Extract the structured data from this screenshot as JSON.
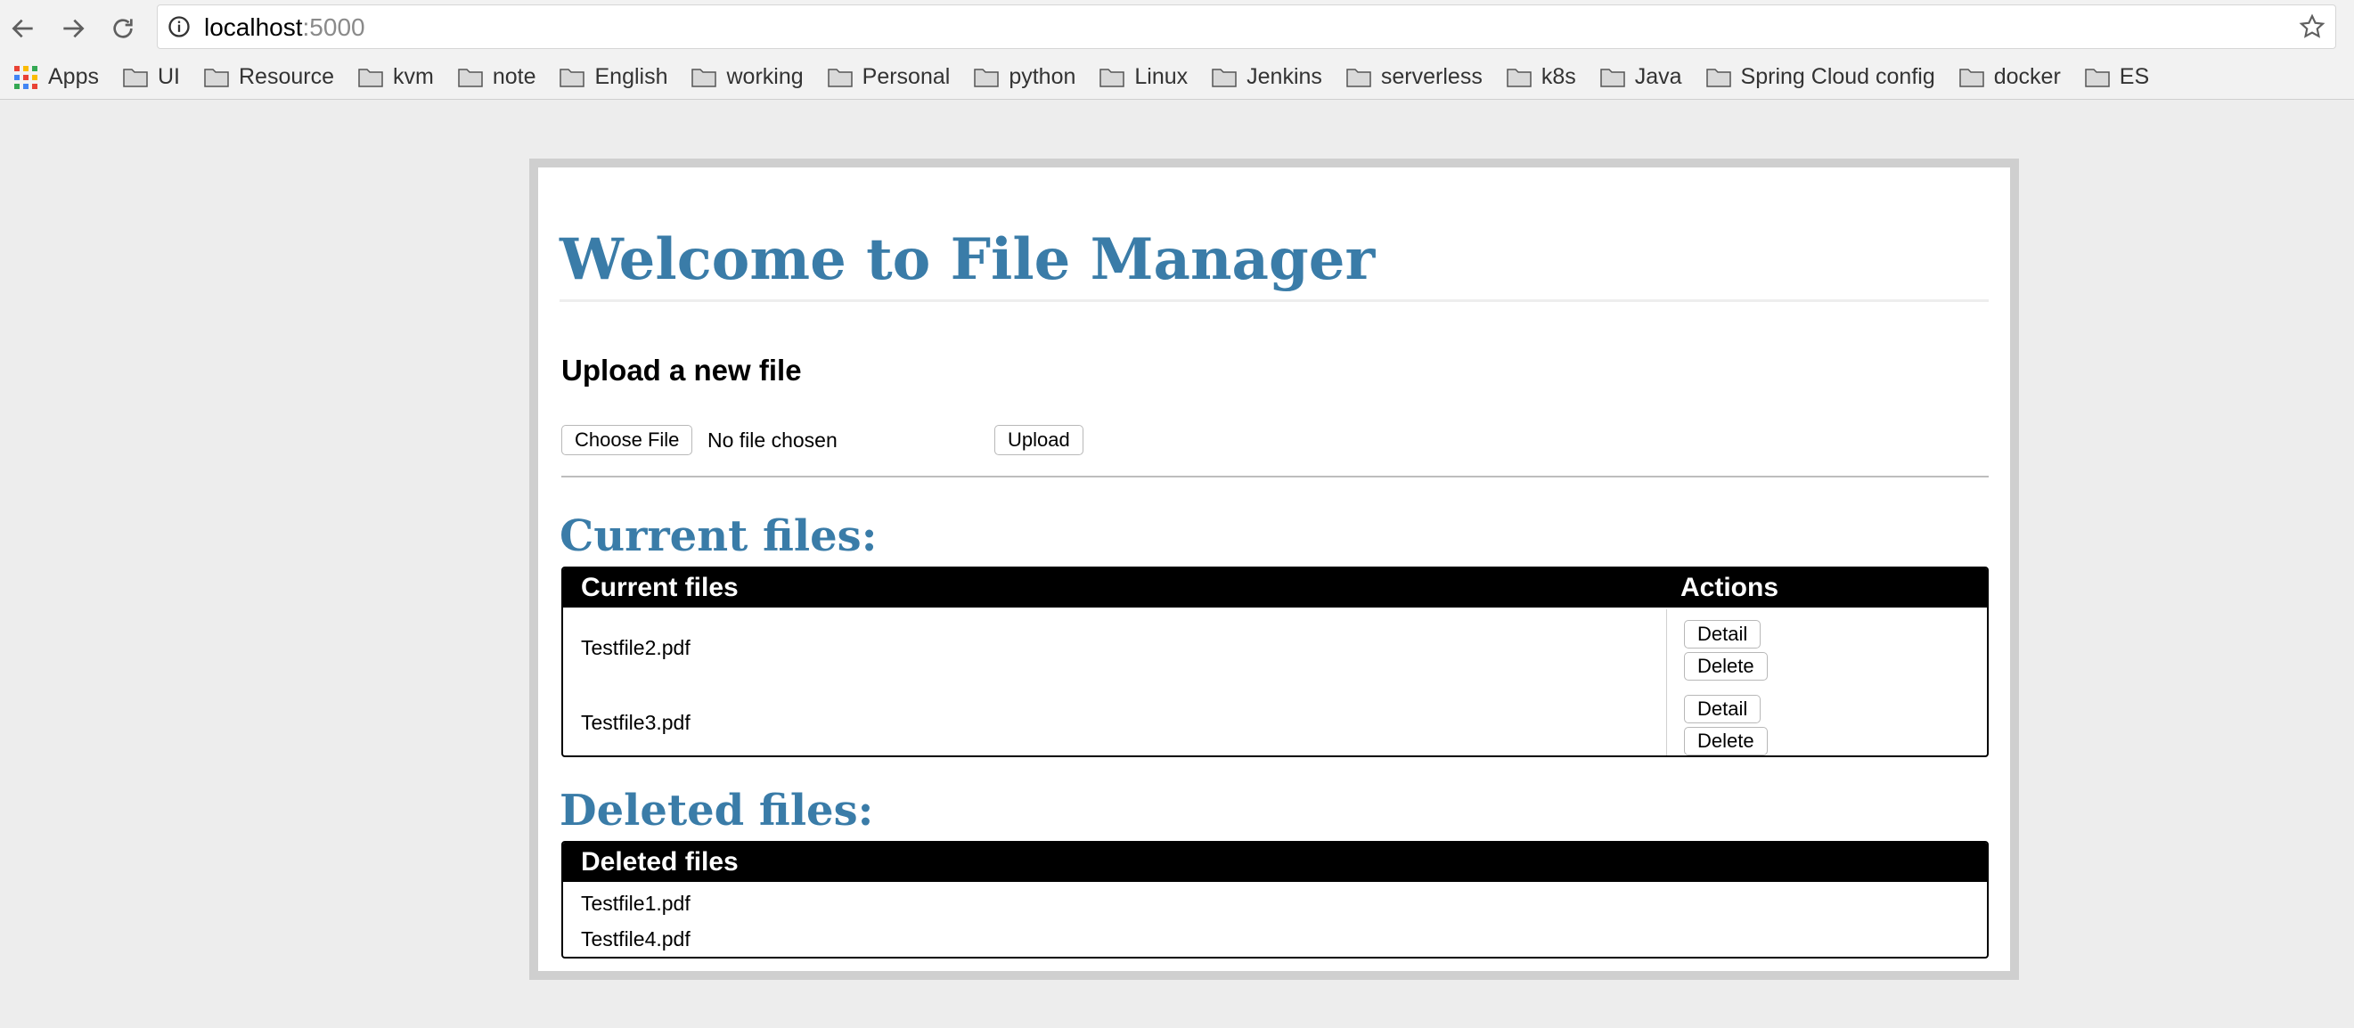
{
  "browser": {
    "url_host": "localhost",
    "url_port": ":5000",
    "bookmarks": [
      "Apps",
      "UI",
      "Resource",
      "kvm",
      "note",
      "English",
      "working",
      "Personal",
      "python",
      "Linux",
      "Jenkins",
      "serverless",
      "k8s",
      "Java",
      "Spring Cloud config",
      "docker",
      "ES"
    ]
  },
  "page": {
    "title": "Welcome to File Manager",
    "upload": {
      "heading": "Upload a new file",
      "choose_label": "Choose File",
      "no_file_text": "No file chosen",
      "upload_label": "Upload"
    },
    "current": {
      "heading": "Current files:",
      "col_files": "Current files",
      "col_actions": "Actions",
      "detail_label": "Detail",
      "delete_label": "Delete",
      "files": [
        "Testfile2.pdf",
        "Testfile3.pdf"
      ]
    },
    "deleted": {
      "heading": "Deleted files:",
      "col_files": "Deleted files",
      "files": [
        "Testfile1.pdf",
        "Testfile4.pdf"
      ]
    }
  },
  "colors": {
    "heading_blue": "#3a7ca8",
    "frame_grey": "#cfcfcf",
    "page_bg": "#ededed"
  }
}
